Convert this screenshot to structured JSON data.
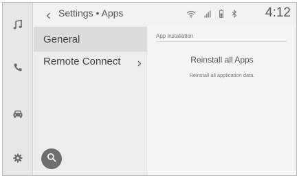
{
  "header": {
    "breadcrumb": "Settings • Apps",
    "time": "4:12"
  },
  "rail": {
    "icons": [
      "music-icon",
      "phone-icon",
      "car-icon",
      "settings-gear-icon"
    ]
  },
  "list": {
    "items": [
      {
        "label": "General",
        "selected": true
      },
      {
        "label": "Remote Connect",
        "selected": false
      }
    ]
  },
  "detail": {
    "section_header": "App installation",
    "action_title": "Reinstall all Apps",
    "action_description": "Reinstall all application data."
  },
  "status": {
    "icons": [
      "wifi-icon",
      "signal-bars-icon",
      "battery-icon",
      "bluetooth-icon"
    ]
  },
  "colors": {
    "rail_bg": "#e7e7e7",
    "list_bg": "#ededed",
    "selected_bg": "#dcdcdc",
    "fab_bg": "#6e6e6e",
    "text": "#444444"
  }
}
